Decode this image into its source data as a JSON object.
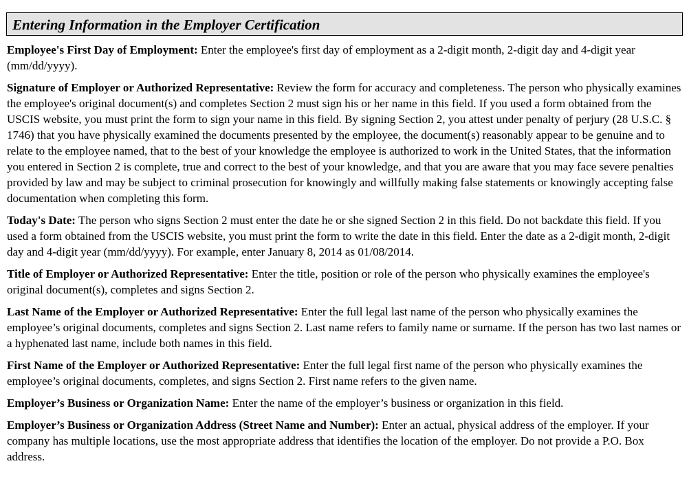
{
  "header": {
    "title": "Entering Information in the Employer Certification"
  },
  "entries": [
    {
      "term": "Employee's First Day of Employment:",
      "text": "Enter the employee's first day of employment as a 2-digit month, 2-digit day and 4-digit year (mm/dd/yyyy)."
    },
    {
      "term": "Signature of Employer or Authorized Representative:",
      "text": "Review the form for accuracy and completeness. The person who physically examines the employee's original document(s) and completes Section 2 must sign his or her name in this field. If you used a form obtained from the USCIS website, you must print the form to sign your name in this field. By signing Section 2, you attest under penalty of perjury (28 U.S.C. § 1746)  that you have physically examined the documents presented by the employee, the document(s) reasonably appear to be genuine and to relate to the employee named, that to the best of your knowledge the employee is authorized to work in the United States, that the information you entered in Section 2 is complete, true and correct to the best of your knowledge, and that you are aware that you may face severe penalties provided by law and may be subject to criminal prosecution for knowingly and willfully making false statements or knowingly accepting false documentation when completing this form."
    },
    {
      "term": "Today's Date:",
      "text": "The person who signs Section 2 must enter the date he or she signed Section 2 in this field. Do not backdate this field. If you used a form obtained from the USCIS website, you must print the form to write the date in this field. Enter the date as a 2-digit month, 2-digit day and 4-digit year (mm/dd/yyyy). For example, enter January 8, 2014 as 01/08/2014."
    },
    {
      "term": "Title of Employer or Authorized Representative:",
      "text": "Enter the title, position or role of the person who physically examines the employee's original document(s), completes and signs Section 2."
    },
    {
      "term": "Last Name of the Employer or Authorized Representative:",
      "text": "Enter the full legal last name of the person who physically examines the employee’s original documents, completes and signs Section 2. Last name refers to family name or surname. If the person has two last names or a hyphenated last name, include both names in this field."
    },
    {
      "term": "First Name of the Employer or Authorized Representative:",
      "text": "Enter the full legal first name of the person who physically examines the employee’s original documents, completes, and signs Section 2. First name refers to the given name."
    },
    {
      "term": "Employer’s Business or Organization Name:",
      "text": "Enter the name of the employer’s business or organization in this field."
    },
    {
      "term": "Employer’s Business or Organization Address (Street Name and Number):",
      "text": "Enter an actual, physical address of the employer. If your company has multiple locations, use the most appropriate address that identifies the location of the employer. Do not provide a P.O. Box address."
    }
  ]
}
